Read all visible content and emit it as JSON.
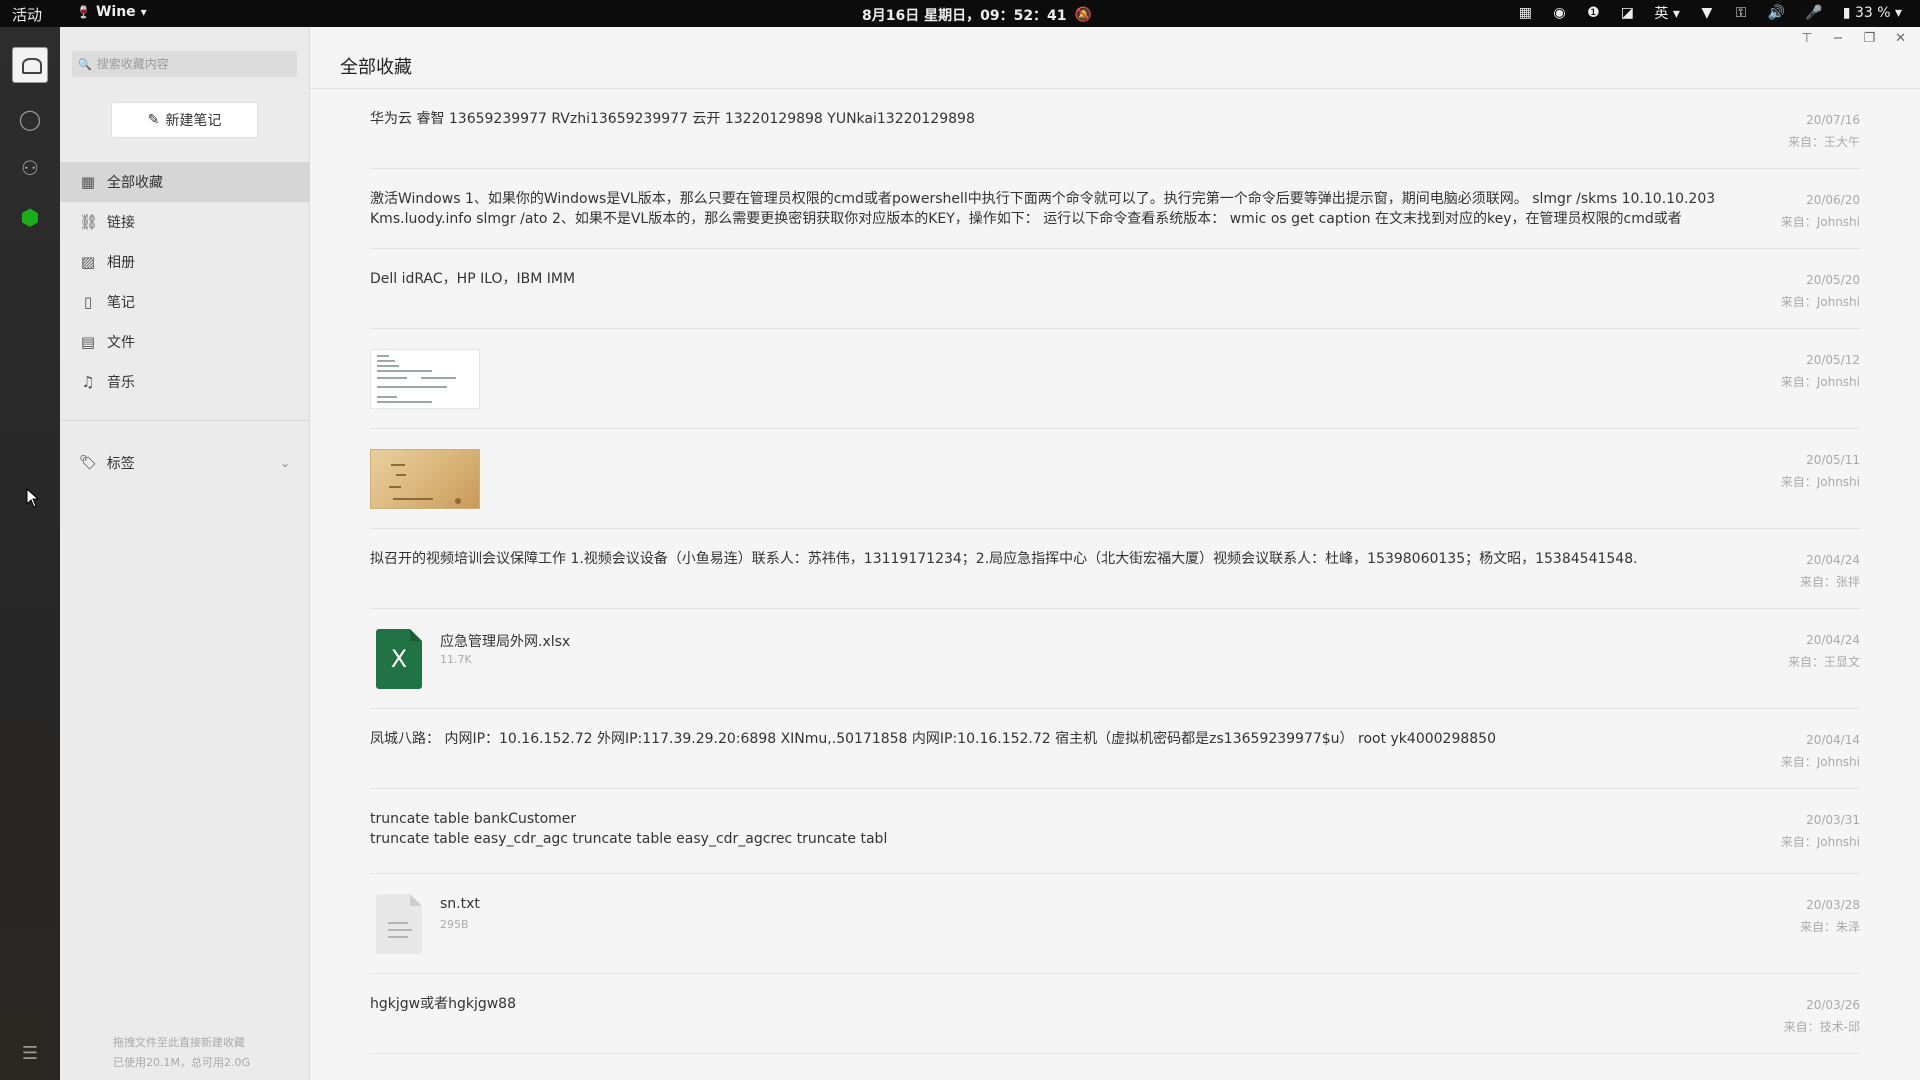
{
  "topbar": {
    "activities": "活动",
    "app_name": "Wine",
    "clock": "8月16日 星期日，09：52：41",
    "input_method": "英",
    "battery": "33 %"
  },
  "sidebar": {
    "search_placeholder": "搜索收藏内容",
    "new_note": "新建笔记",
    "items": [
      {
        "label": "全部收藏",
        "icon": "grid-icon"
      },
      {
        "label": "链接",
        "icon": "link-icon"
      },
      {
        "label": "相册",
        "icon": "image-icon"
      },
      {
        "label": "笔记",
        "icon": "note-icon"
      },
      {
        "label": "文件",
        "icon": "file-icon"
      },
      {
        "label": "音乐",
        "icon": "music-icon"
      }
    ],
    "tags_label": "标签",
    "storage_line1": "拖拽文件至此直接新建收藏",
    "storage_line2": "已使用20.1M，总可用2.0G"
  },
  "main": {
    "title": "全部收藏",
    "items": [
      {
        "text": "华为云  睿智 13659239977 RVzhi13659239977  云开 13220129898 YUNkai13220129898",
        "date": "20/07/16",
        "source": "来自：王大午"
      },
      {
        "text": "激活Windows 1、如果你的Windows是VL版本，那么只要在管理员权限的cmd或者powershell中执行下面两个命令就可以了。执行完第一个命令后要等弹出提示窗，期间电脑必须联网。 slmgr /skms 10.10.10.203    Kms.luody.info slmgr /ato 2、如果不是VL版本的，那么需要更换密钥获取你对应版本的KEY，操作如下： 运行以下命令查看系统版本： wmic os get caption 在文末找到对应的key，在管理员权限的cmd或者",
        "date": "20/06/20",
        "source": "来自：Johnshi"
      },
      {
        "text": "Dell idRAC，HP ILO，IBM IMM",
        "date": "20/05/20",
        "source": "来自：Johnshi"
      },
      {
        "date": "20/05/12",
        "source": "来自：Johnshi"
      },
      {
        "date": "20/05/11",
        "source": "来自：Johnshi"
      },
      {
        "text": "拟召开的视频培训会议保障工作 1.视频会议设备（小鱼易连）联系人：苏祎伟，13119171234；2.局应急指挥中心（北大街宏福大厦）视频会议联系人：杜峰，15398060135；杨文昭，15384541548.",
        "date": "20/04/24",
        "source": "来自：张拌"
      },
      {
        "file_name": "应急管理局外网.xlsx",
        "file_size": "11.7K",
        "file_glyph": "X",
        "date": "20/04/24",
        "source": "来自：王显文"
      },
      {
        "text": "凤城八路： 内网IP：10.16.152.72 外网IP:117.39.29.20:6898 XINmu,.50171858  内网IP:10.16.152.72 宿主机（虚拟机密码都是zs13659239977$u） root yk4000298850",
        "date": "20/04/14",
        "source": "来自：Johnshi"
      },
      {
        "text": "truncate table bankCustomer\ntruncate table easy_cdr_agc truncate table easy_cdr_agcrec truncate tabl",
        "date": "20/03/31",
        "source": "来自：Johnshi"
      },
      {
        "file_name": "sn.txt",
        "file_size": "295B",
        "date": "20/03/28",
        "source": "来自：朱泽"
      },
      {
        "text": "hgkjgw或者hgkjgw88",
        "date": "20/03/26",
        "source": "来自：技术-邱"
      }
    ]
  }
}
